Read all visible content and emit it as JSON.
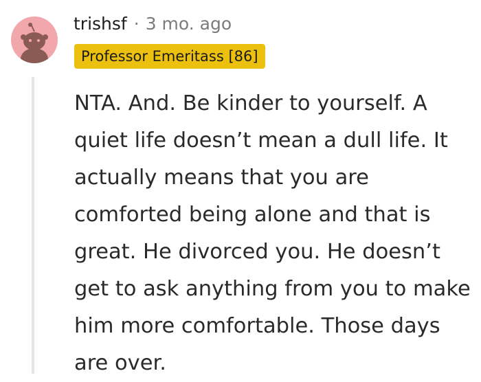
{
  "comment": {
    "username": "trishsf",
    "separator": "·",
    "timestamp": "3 mo. ago",
    "flair": "Professor Emeritass [86]",
    "body": "NTA. And. Be kinder to yourself. A quiet life doesn’t mean a dull life. It actually means that you are comforted being alone and that is great. He divorced you. He doesn’t get to ask anything from you to make him more comfortable. Those days are over.",
    "avatar_icon": "snoo-avatar-icon",
    "colors": {
      "avatar_bg": "#f2a7ad",
      "avatar_figure": "#8a5a55",
      "flair_bg": "#ebc00f",
      "thread_line": "#e5e6e8",
      "meta_text": "#787c7e"
    }
  }
}
